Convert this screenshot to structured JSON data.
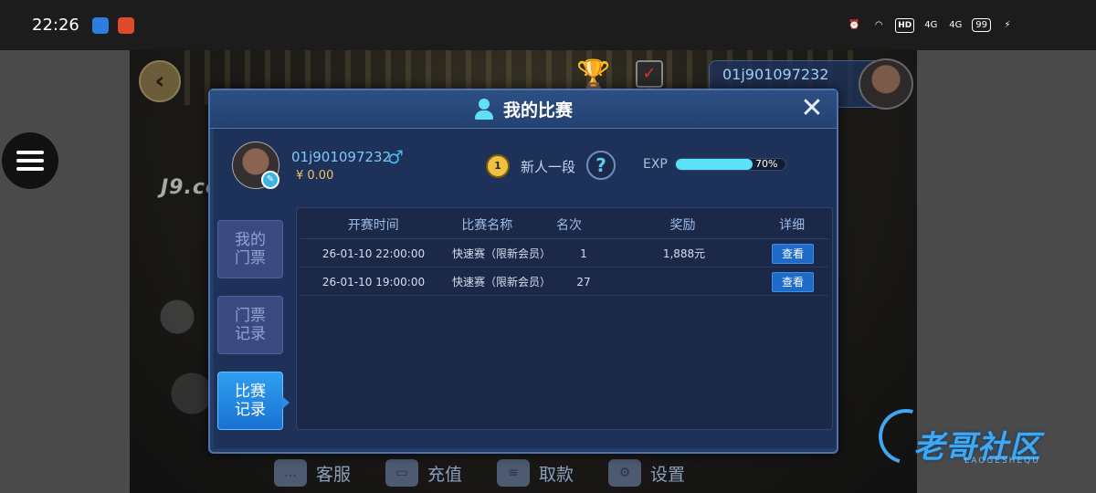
{
  "status_bar": {
    "time": "22:26",
    "hd": "HD",
    "signal_1": "4G",
    "signal_2": "4G",
    "battery": "99"
  },
  "game_bg": {
    "title_fragment": "J9.co",
    "top_username": "01j901097232"
  },
  "dialog": {
    "title": "我的比赛",
    "close_glyph": "✕",
    "profile": {
      "username": "01j901097232",
      "gender_glyph": "♂",
      "balance": "¥ 0.00",
      "rank_number": "1",
      "rank_label": "新人一段",
      "help_glyph": "?",
      "exp_label": "EXP",
      "exp_percent_text": "70%",
      "exp_fraction": 0.7
    },
    "tabs": [
      {
        "label_line1": "我的",
        "label_line2": "门票",
        "active": false
      },
      {
        "label_line1": "门票",
        "label_line2": "记录",
        "active": false
      },
      {
        "label_line1": "比赛",
        "label_line2": "记录",
        "active": true
      }
    ],
    "table": {
      "headers": [
        "开赛时间",
        "比赛名称",
        "名次",
        "奖励",
        "详细"
      ],
      "rows": [
        {
          "time": "26-01-10 22:00:00",
          "name": "快速赛（限新会员）",
          "rank": "1",
          "reward": "1,888元",
          "action": "查看"
        },
        {
          "time": "26-01-10 19:00:00",
          "name": "快速赛（限新会员）",
          "rank": "27",
          "reward": "",
          "action": "查看"
        }
      ]
    }
  },
  "bottom_nav": [
    {
      "label": "客服",
      "icon": "chat-icon"
    },
    {
      "label": "充值",
      "icon": "card-icon"
    },
    {
      "label": "取款",
      "icon": "wallet-icon"
    },
    {
      "label": "设置",
      "icon": "gear-icon"
    }
  ],
  "watermark": {
    "text": "老哥社区",
    "sub": "LAOGESHEQU"
  },
  "colors": {
    "accent_cyan": "#5ae3f7",
    "active_tab_blue": "#1a72d1",
    "dialog_bg": "#1e3259",
    "money_gold": "#e8c36a"
  }
}
